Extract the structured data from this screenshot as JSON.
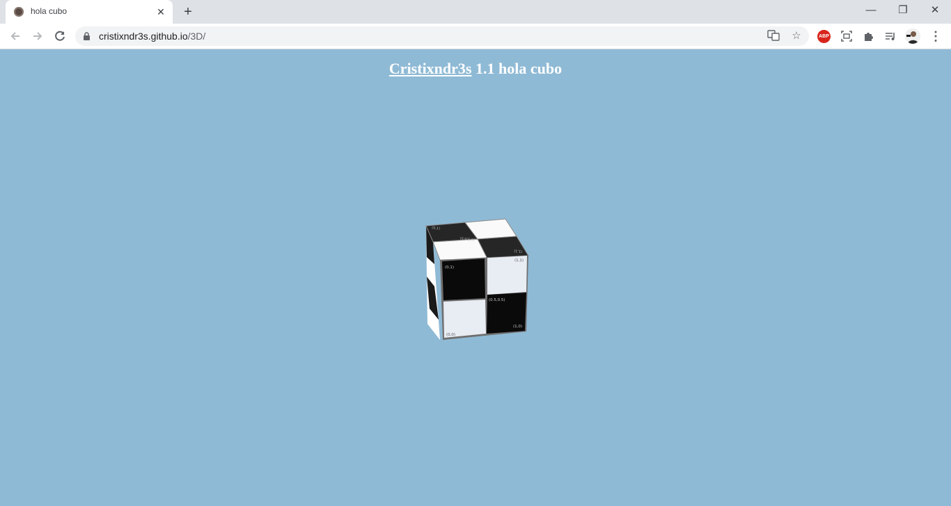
{
  "browser": {
    "tab_title": "hola cubo",
    "url_host": "cristixndr3s.github.io",
    "url_path": "/3D/",
    "new_tab": "+",
    "close_tab": "✕",
    "minimize": "—",
    "restore": "❐",
    "close_window": "✕",
    "abp_label": "ABP"
  },
  "page": {
    "heading_link": "Cristixndr3s",
    "heading_rest": " 1.1 hola cubo"
  },
  "cube": {
    "front_labels": {
      "top_left": "(0,1)",
      "top_right": "(1,1)",
      "center": "(0.5,0.5)",
      "bottom_right": "(1,0)",
      "bottom_left": "(0,0)"
    },
    "top_labels": {
      "back_left": "(0,1)",
      "center": "(0.5,0.5)",
      "front_right": "(1,1)"
    },
    "colors": {
      "dark": "#0a0a0a",
      "light": "#e8ecf3",
      "top_dark": "#262626",
      "top_light": "#fafafa",
      "background": "#8fbad5"
    }
  }
}
